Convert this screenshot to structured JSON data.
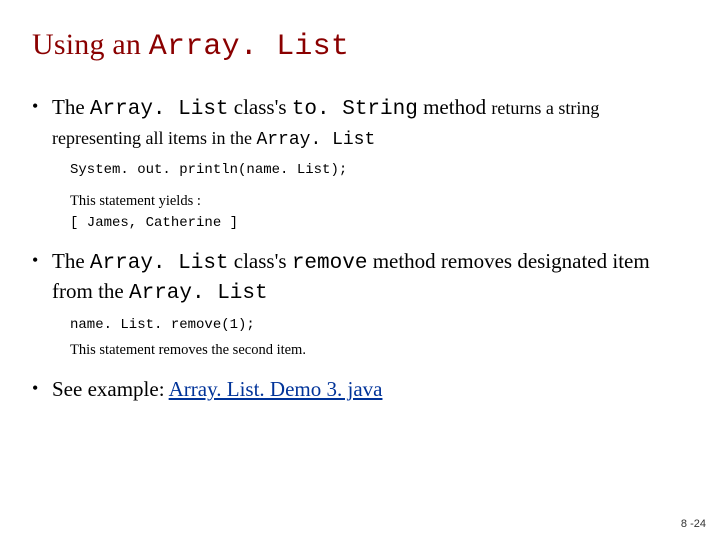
{
  "title": {
    "prefix": "Using an ",
    "mono": "Array. List"
  },
  "bullets": [
    {
      "parts": [
        {
          "t": "The ",
          "c": ""
        },
        {
          "t": "Array. List",
          "c": "mono"
        },
        {
          "t": " class's ",
          "c": ""
        },
        {
          "t": "to. String",
          "c": "mono"
        },
        {
          "t": " method ",
          "c": ""
        },
        {
          "t": "returns a string representing all items in the ",
          "c": "sm"
        },
        {
          "t": "Array. List",
          "c": "mono sm"
        }
      ],
      "sub": [
        {
          "t": "System. out. println(name. List);",
          "c": "code"
        },
        {
          "t": "",
          "c": "gap"
        },
        {
          "t": "This statement yields :",
          "c": "desc"
        },
        {
          "t": "[ James, Catherine ]",
          "c": "code"
        }
      ]
    },
    {
      "parts": [
        {
          "t": "The ",
          "c": ""
        },
        {
          "t": "Array. List",
          "c": "mono"
        },
        {
          "t": " class's ",
          "c": ""
        },
        {
          "t": "remove",
          "c": "mono"
        },
        {
          "t": " method removes designated item from the ",
          "c": ""
        },
        {
          "t": "Array. List",
          "c": "mono"
        }
      ],
      "sub": [
        {
          "t": "name. List. remove(1);",
          "c": "code"
        },
        {
          "t": "This statement removes the second item.",
          "c": "desc"
        }
      ]
    },
    {
      "parts": [
        {
          "t": "See example: ",
          "c": ""
        },
        {
          "t": "Array. List. Demo 3. java",
          "c": "link"
        }
      ],
      "sub": []
    }
  ],
  "pagenum": "8 -24"
}
